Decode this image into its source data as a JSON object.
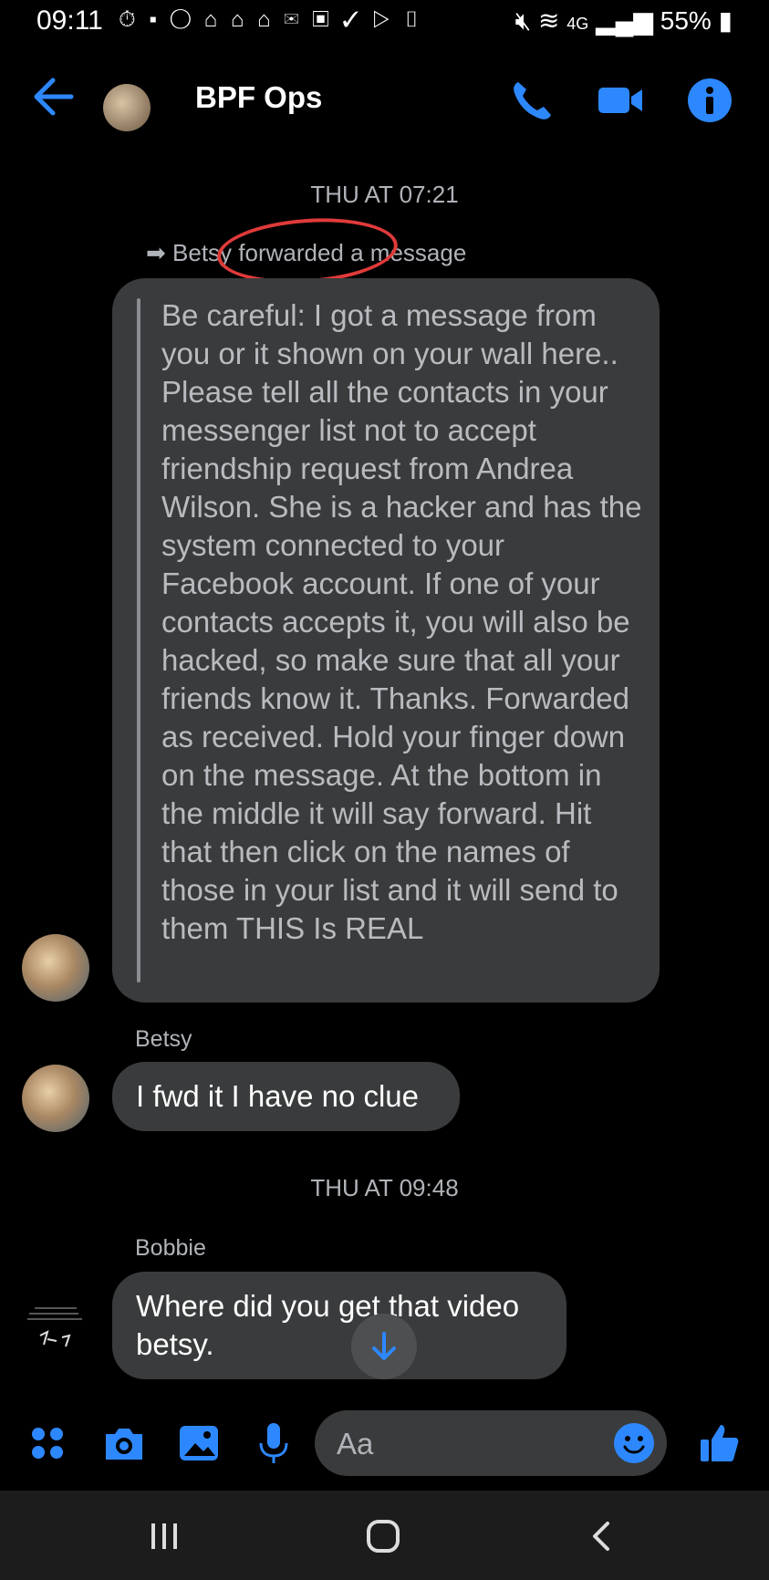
{
  "status_bar": {
    "time": "09:11",
    "battery": "55%",
    "network": "4G"
  },
  "header": {
    "title": "BPF Ops"
  },
  "colors": {
    "accent": "#2d88ff",
    "bubble": "#3a3b3c",
    "annotation_circle": "#e03a3a"
  },
  "messages": {
    "stamp1": "THU AT 07:21",
    "forward_note": "Betsy forwarded a message",
    "forwarded_text": "Be careful: I got a message from you or it shown on your wall here..  Please tell all the contacts in your messenger list not to accept friendship request from Andrea Wilson. She is a hacker and has the system connected to your Facebook account. If one of your contacts accepts it, you will also be hacked, so make sure that all your friends know it. Thanks. Forwarded as received. Hold your finger down on the message. At the bottom in the middle it will say forward. Hit that then click on the names of those in your list and it will send to them THIS Is REAL",
    "sender1": "Betsy",
    "reply1": "I fwd it I have no clue",
    "stamp2": "THU AT 09:48",
    "sender2": "Bobbie",
    "reply2": "Where did you get that video betsy."
  },
  "composer": {
    "placeholder": "Aa"
  },
  "icons": [
    "back-arrow-icon",
    "phone-icon",
    "video-camera-icon",
    "info-icon",
    "down-arrow-icon",
    "apps-grid-icon",
    "camera-icon",
    "gallery-icon",
    "microphone-icon",
    "emoji-icon",
    "thumbs-up-icon",
    "recent-apps-icon",
    "home-icon",
    "nav-back-icon"
  ]
}
